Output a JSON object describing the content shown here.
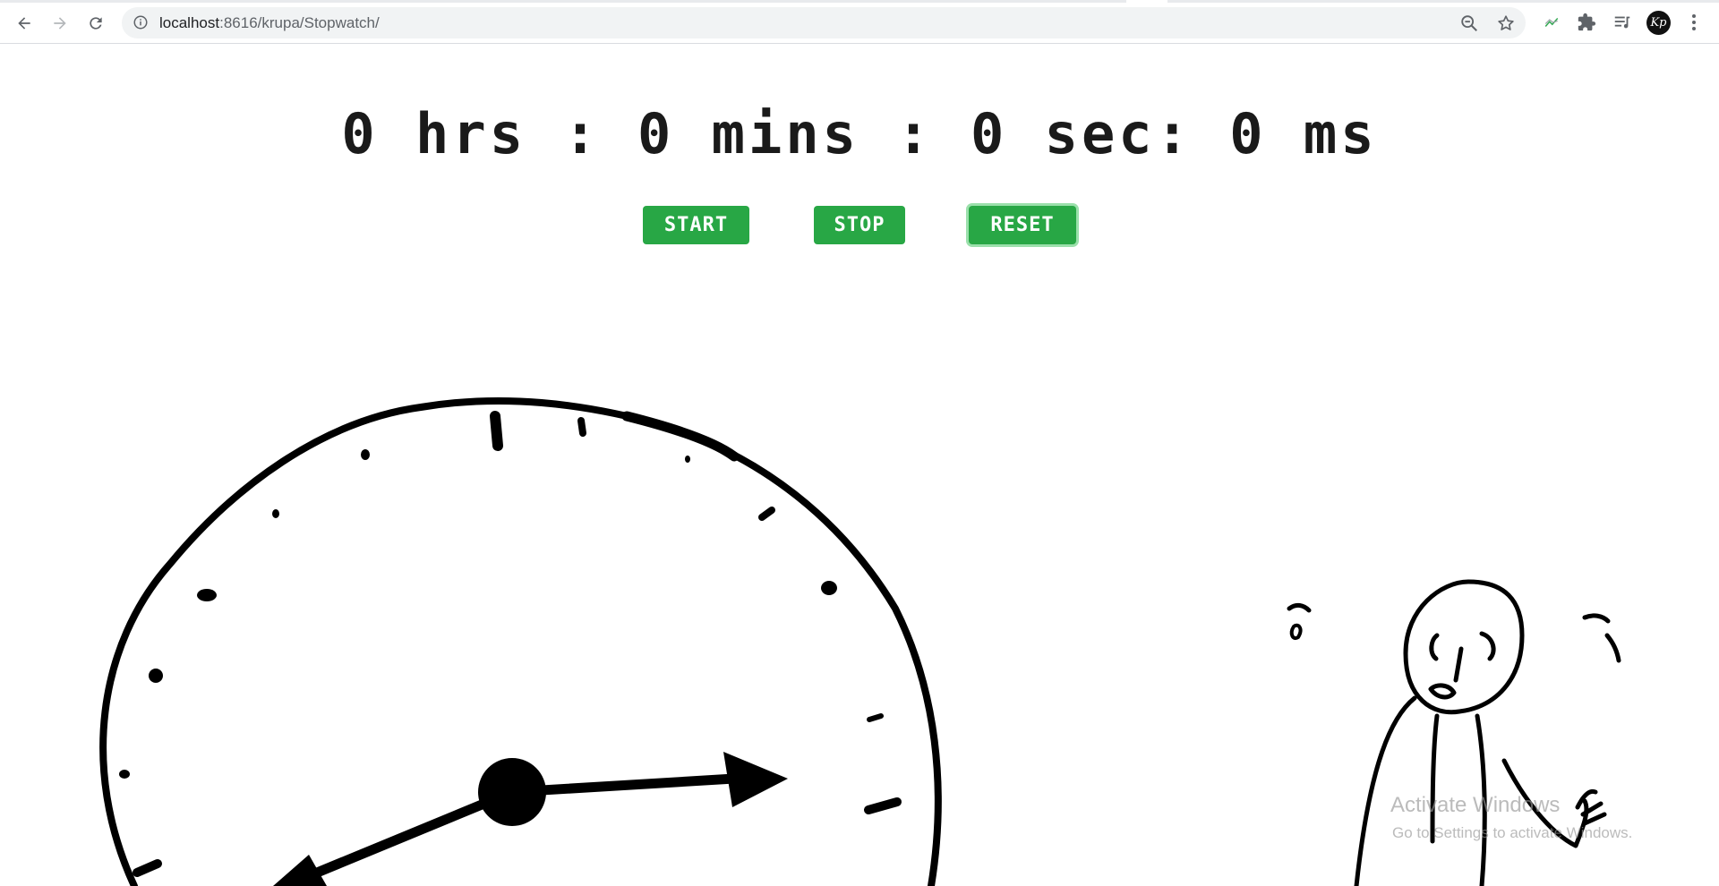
{
  "browser": {
    "url_host": "localhost",
    "url_rest": ":8616/krupa/Stopwatch/",
    "avatar_initials": "Kp",
    "icons": {
      "back": "back-arrow-icon",
      "forward": "forward-arrow-icon",
      "reload": "reload-icon",
      "site_info": "info-icon",
      "zoom": "zoom-out-icon",
      "bookmark": "star-icon",
      "extension": "chart-extension-icon",
      "extensions": "puzzle-icon",
      "media": "media-queue-icon",
      "menu": "kebab-menu-icon"
    }
  },
  "stopwatch": {
    "display": "0 hrs : 0 mins : 0 sec: 0 ms",
    "buttons": {
      "start": "START",
      "stop": "STOP",
      "reset": "RESET"
    },
    "button_color": "#28a745"
  },
  "os_watermark": {
    "title": "Activate Windows",
    "subtitle": "Go to Settings to activate Windows."
  }
}
